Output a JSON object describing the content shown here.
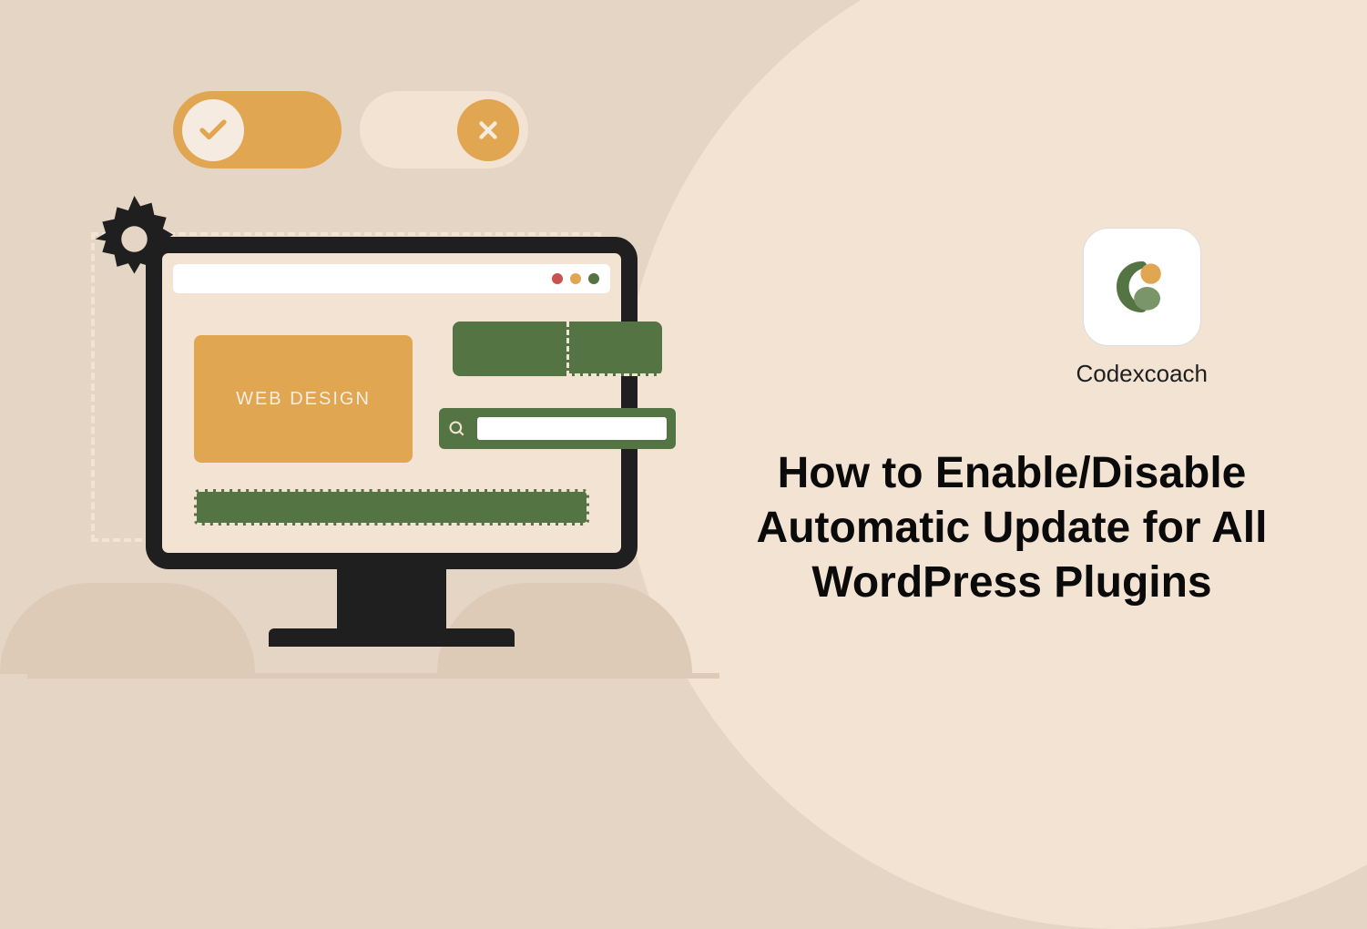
{
  "brand": {
    "name": "Codexcoach"
  },
  "headline": "How to Enable/Disable Automatic Update for All WordPress Plugins",
  "illustration": {
    "card_label": "WEB DESIGN"
  }
}
